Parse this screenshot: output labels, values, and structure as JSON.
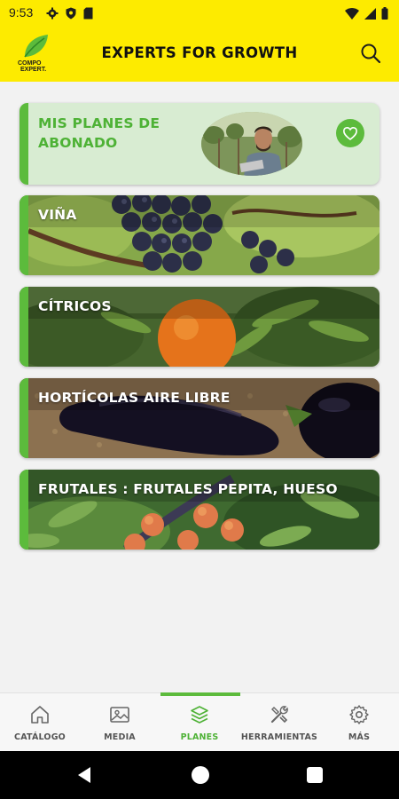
{
  "status_bar": {
    "time": "9:53"
  },
  "app_bar": {
    "logo_line1": "COMPO",
    "logo_line2": "EXPERT.",
    "title": "EXPERTS FOR GROWTH"
  },
  "cards": [
    {
      "label": "MIS PLANES DE ABONADO"
    },
    {
      "label": "VIÑA"
    },
    {
      "label": "CÍTRICOS"
    },
    {
      "label": "HORTÍCOLAS AIRE LIBRE"
    },
    {
      "label": "FRUTALES : FRUTALES PEPITA, HUESO"
    }
  ],
  "nav": {
    "items": [
      {
        "label": "CATÁLOGO"
      },
      {
        "label": "MEDIA"
      },
      {
        "label": "PLANES"
      },
      {
        "label": "HERRAMIENTAS"
      },
      {
        "label": "MÁS"
      }
    ],
    "active": "PLANES"
  },
  "colors": {
    "brand_yellow": "#fdeb00",
    "accent_green": "#5cbb3c",
    "plans_card_bg": "#d8ecd2"
  }
}
